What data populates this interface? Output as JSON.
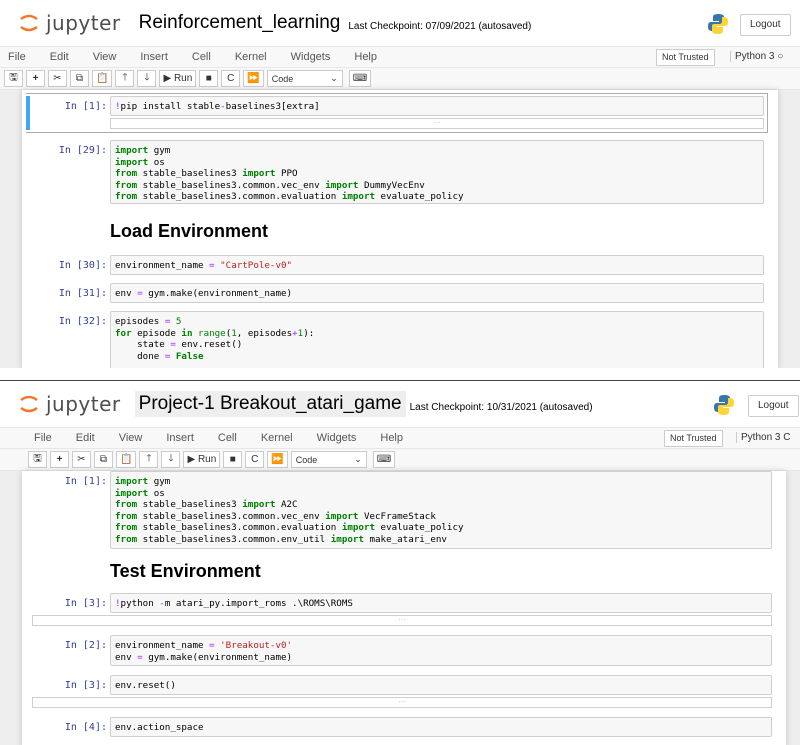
{
  "notebook1": {
    "app_name": "jupyter",
    "title": "Reinforcement_learning",
    "checkpoint": "Last Checkpoint: 07/09/2021  (autosaved)",
    "logout": "Logout",
    "trusted": "Not Trusted",
    "kernel": "Python 3",
    "menu": [
      "File",
      "Edit",
      "View",
      "Insert",
      "Cell",
      "Kernel",
      "Widgets",
      "Help"
    ],
    "toolbar": {
      "run_label": "Run",
      "cell_type": "Code"
    },
    "cells": [
      {
        "prompt": "In [1]:",
        "code": "!pip install stable-baselines3[extra]"
      },
      {
        "prompt": "In [29]:",
        "code": "import gym\nimport os\nfrom stable_baselines3 import PPO\nfrom stable_baselines3.common.vec_env import DummyVecEnv\nfrom stable_baselines3.common.evaluation import evaluate_policy"
      },
      {
        "heading": "Load Environment"
      },
      {
        "prompt": "In [30]:",
        "code": "environment_name = \"CartPole-v0\""
      },
      {
        "prompt": "In [31]:",
        "code": "env = gym.make(environment_name)"
      },
      {
        "prompt": "In [32]:",
        "code": "episodes = 5\nfor episode in range(1, episodes+1):\n    state = env.reset()\n    done = False"
      }
    ]
  },
  "notebook2": {
    "app_name": "jupyter",
    "title": "Project-1 Breakout_atari_game",
    "checkpoint": "Last Checkpoint: 10/31/2021  (autosaved)",
    "logout": "Logout",
    "trusted": "Not Trusted",
    "kernel": "Python 3",
    "menu": [
      "File",
      "Edit",
      "View",
      "Insert",
      "Cell",
      "Kernel",
      "Widgets",
      "Help"
    ],
    "toolbar": {
      "run_label": "Run",
      "cell_type": "Code"
    },
    "cells": [
      {
        "prompt": "In [1]:",
        "code": "import gym\nimport os\nfrom stable_baselines3 import A2C\nfrom stable_baselines3.common.vec_env import VecFrameStack\nfrom stable_baselines3.common.evaluation import evaluate_policy\nfrom stable_baselines3.common.env_util import make_atari_env"
      },
      {
        "heading": "Test Environment"
      },
      {
        "prompt": "In [3]:",
        "code": "!python -m atari_py.import_roms .\\ROMS\\ROMS"
      },
      {
        "prompt": "In [2]:",
        "code": "environment_name = 'Breakout-v0'\nenv = gym.make(environment_name)"
      },
      {
        "prompt": "In [3]:",
        "code": "env.reset()"
      },
      {
        "prompt": "In [4]:",
        "code": "env.action_space"
      }
    ]
  },
  "colors": {
    "prompt": "#303f9f",
    "keyword": "#008000",
    "string": "#ba2121",
    "selected": "#42a5f5"
  }
}
